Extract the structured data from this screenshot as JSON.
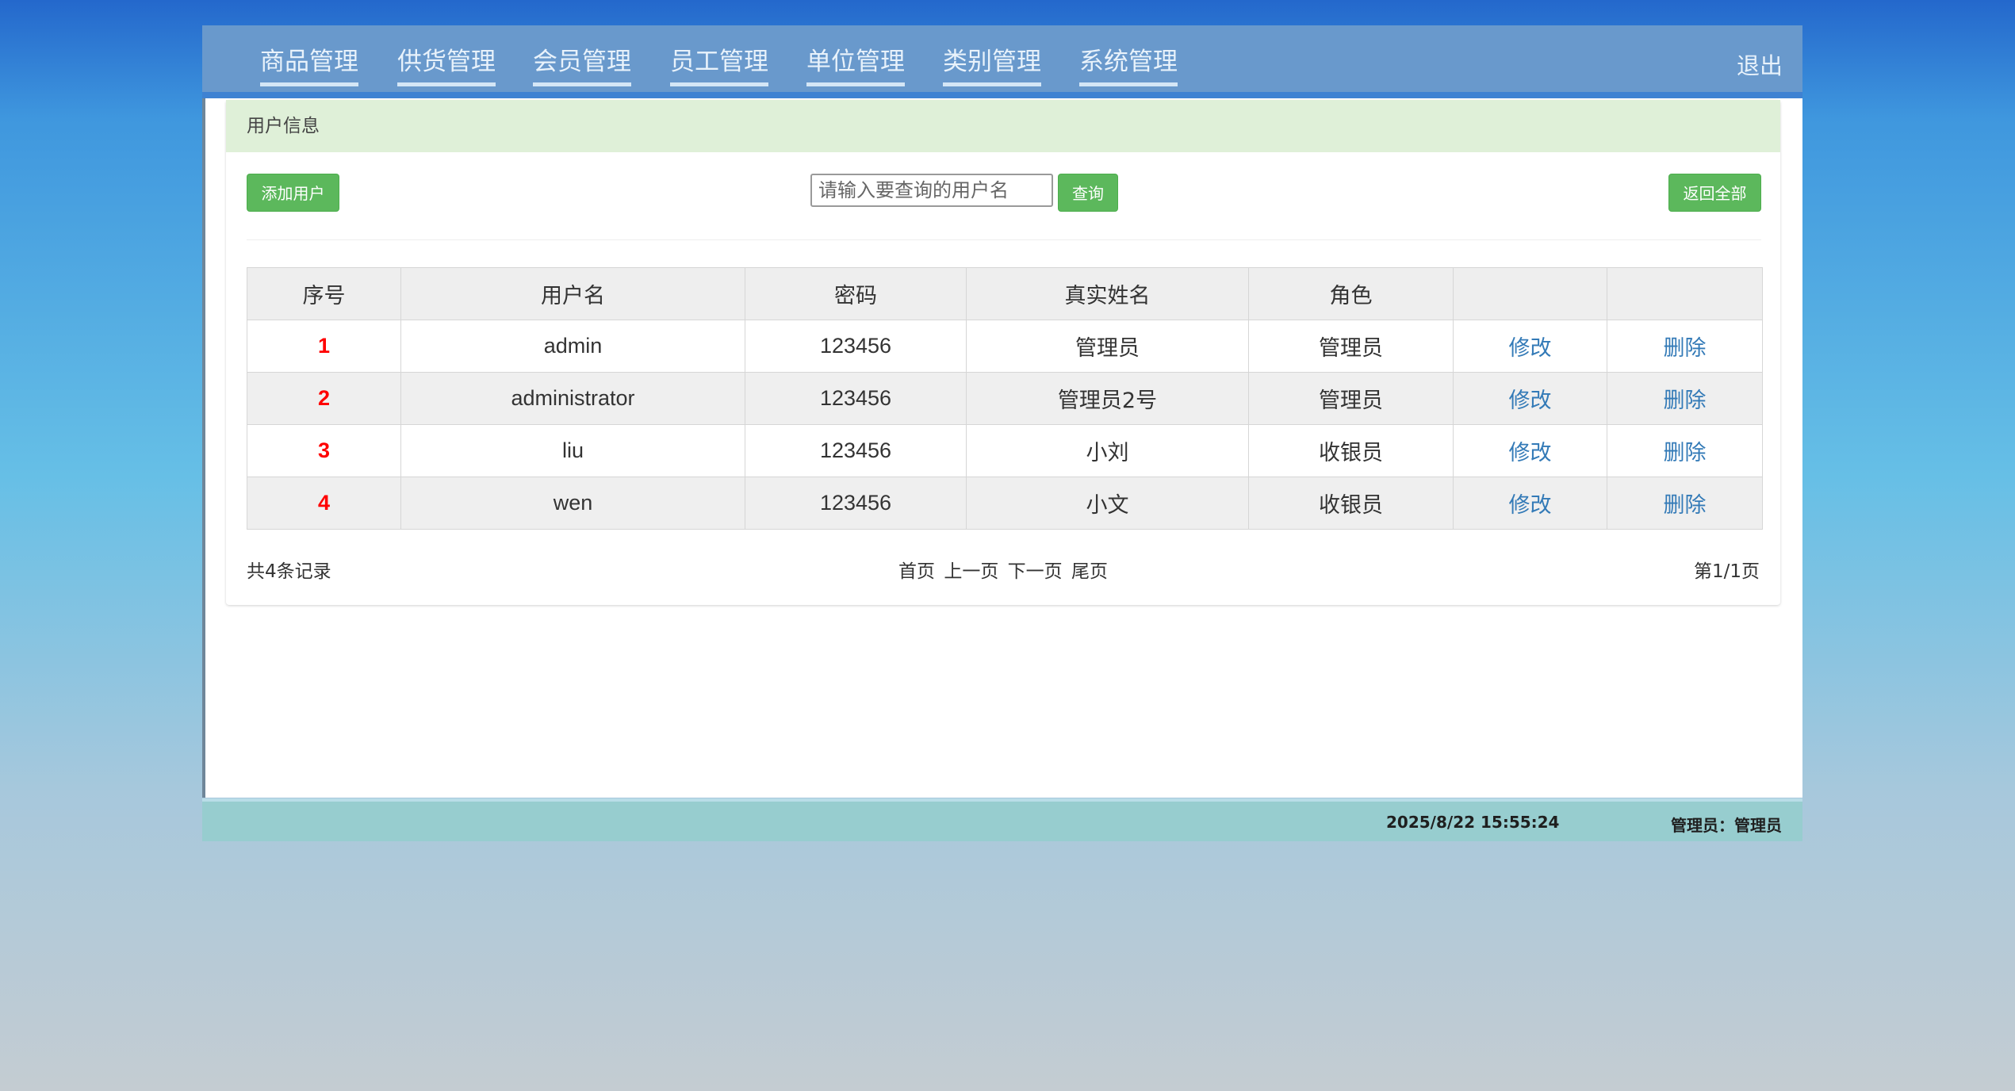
{
  "nav": {
    "items": [
      "商品管理",
      "供货管理",
      "会员管理",
      "员工管理",
      "单位管理",
      "类别管理",
      "系统管理"
    ],
    "logout": "退出"
  },
  "panel": {
    "title": "用户信息",
    "add_button": "添加用户",
    "search": {
      "placeholder": "请输入要查询的用户名",
      "value": "",
      "button": "查询"
    },
    "reset_button": "返回全部"
  },
  "table": {
    "columns": [
      "序号",
      "用户名",
      "密码",
      "真实姓名",
      "角色",
      "",
      ""
    ],
    "rows": [
      {
        "index": "1",
        "username": "admin",
        "password": "123456",
        "realname": "管理员",
        "role": "管理员",
        "edit": "修改",
        "delete": "删除"
      },
      {
        "index": "2",
        "username": "administrator",
        "password": "123456",
        "realname": "管理员2号",
        "role": "管理员",
        "edit": "修改",
        "delete": "删除"
      },
      {
        "index": "3",
        "username": "liu",
        "password": "123456",
        "realname": "小刘",
        "role": "收银员",
        "edit": "修改",
        "delete": "删除"
      },
      {
        "index": "4",
        "username": "wen",
        "password": "123456",
        "realname": "小文",
        "role": "收银员",
        "edit": "修改",
        "delete": "删除"
      }
    ]
  },
  "pagination": {
    "total": "共4条记录",
    "first": "首页",
    "prev": "上一页",
    "next": "下一页",
    "last": "尾页",
    "page_info": "第1/1页"
  },
  "status": {
    "datetime": "2025/8/22 15:55:24",
    "user": "管理员：管理员"
  },
  "colors": {
    "navbar": "#6999cc",
    "panel_header": "#dff0d8",
    "button": "#5cb85c",
    "link": "#337ab7",
    "index": "#ff0000",
    "statusbar": "#97cdcf"
  }
}
